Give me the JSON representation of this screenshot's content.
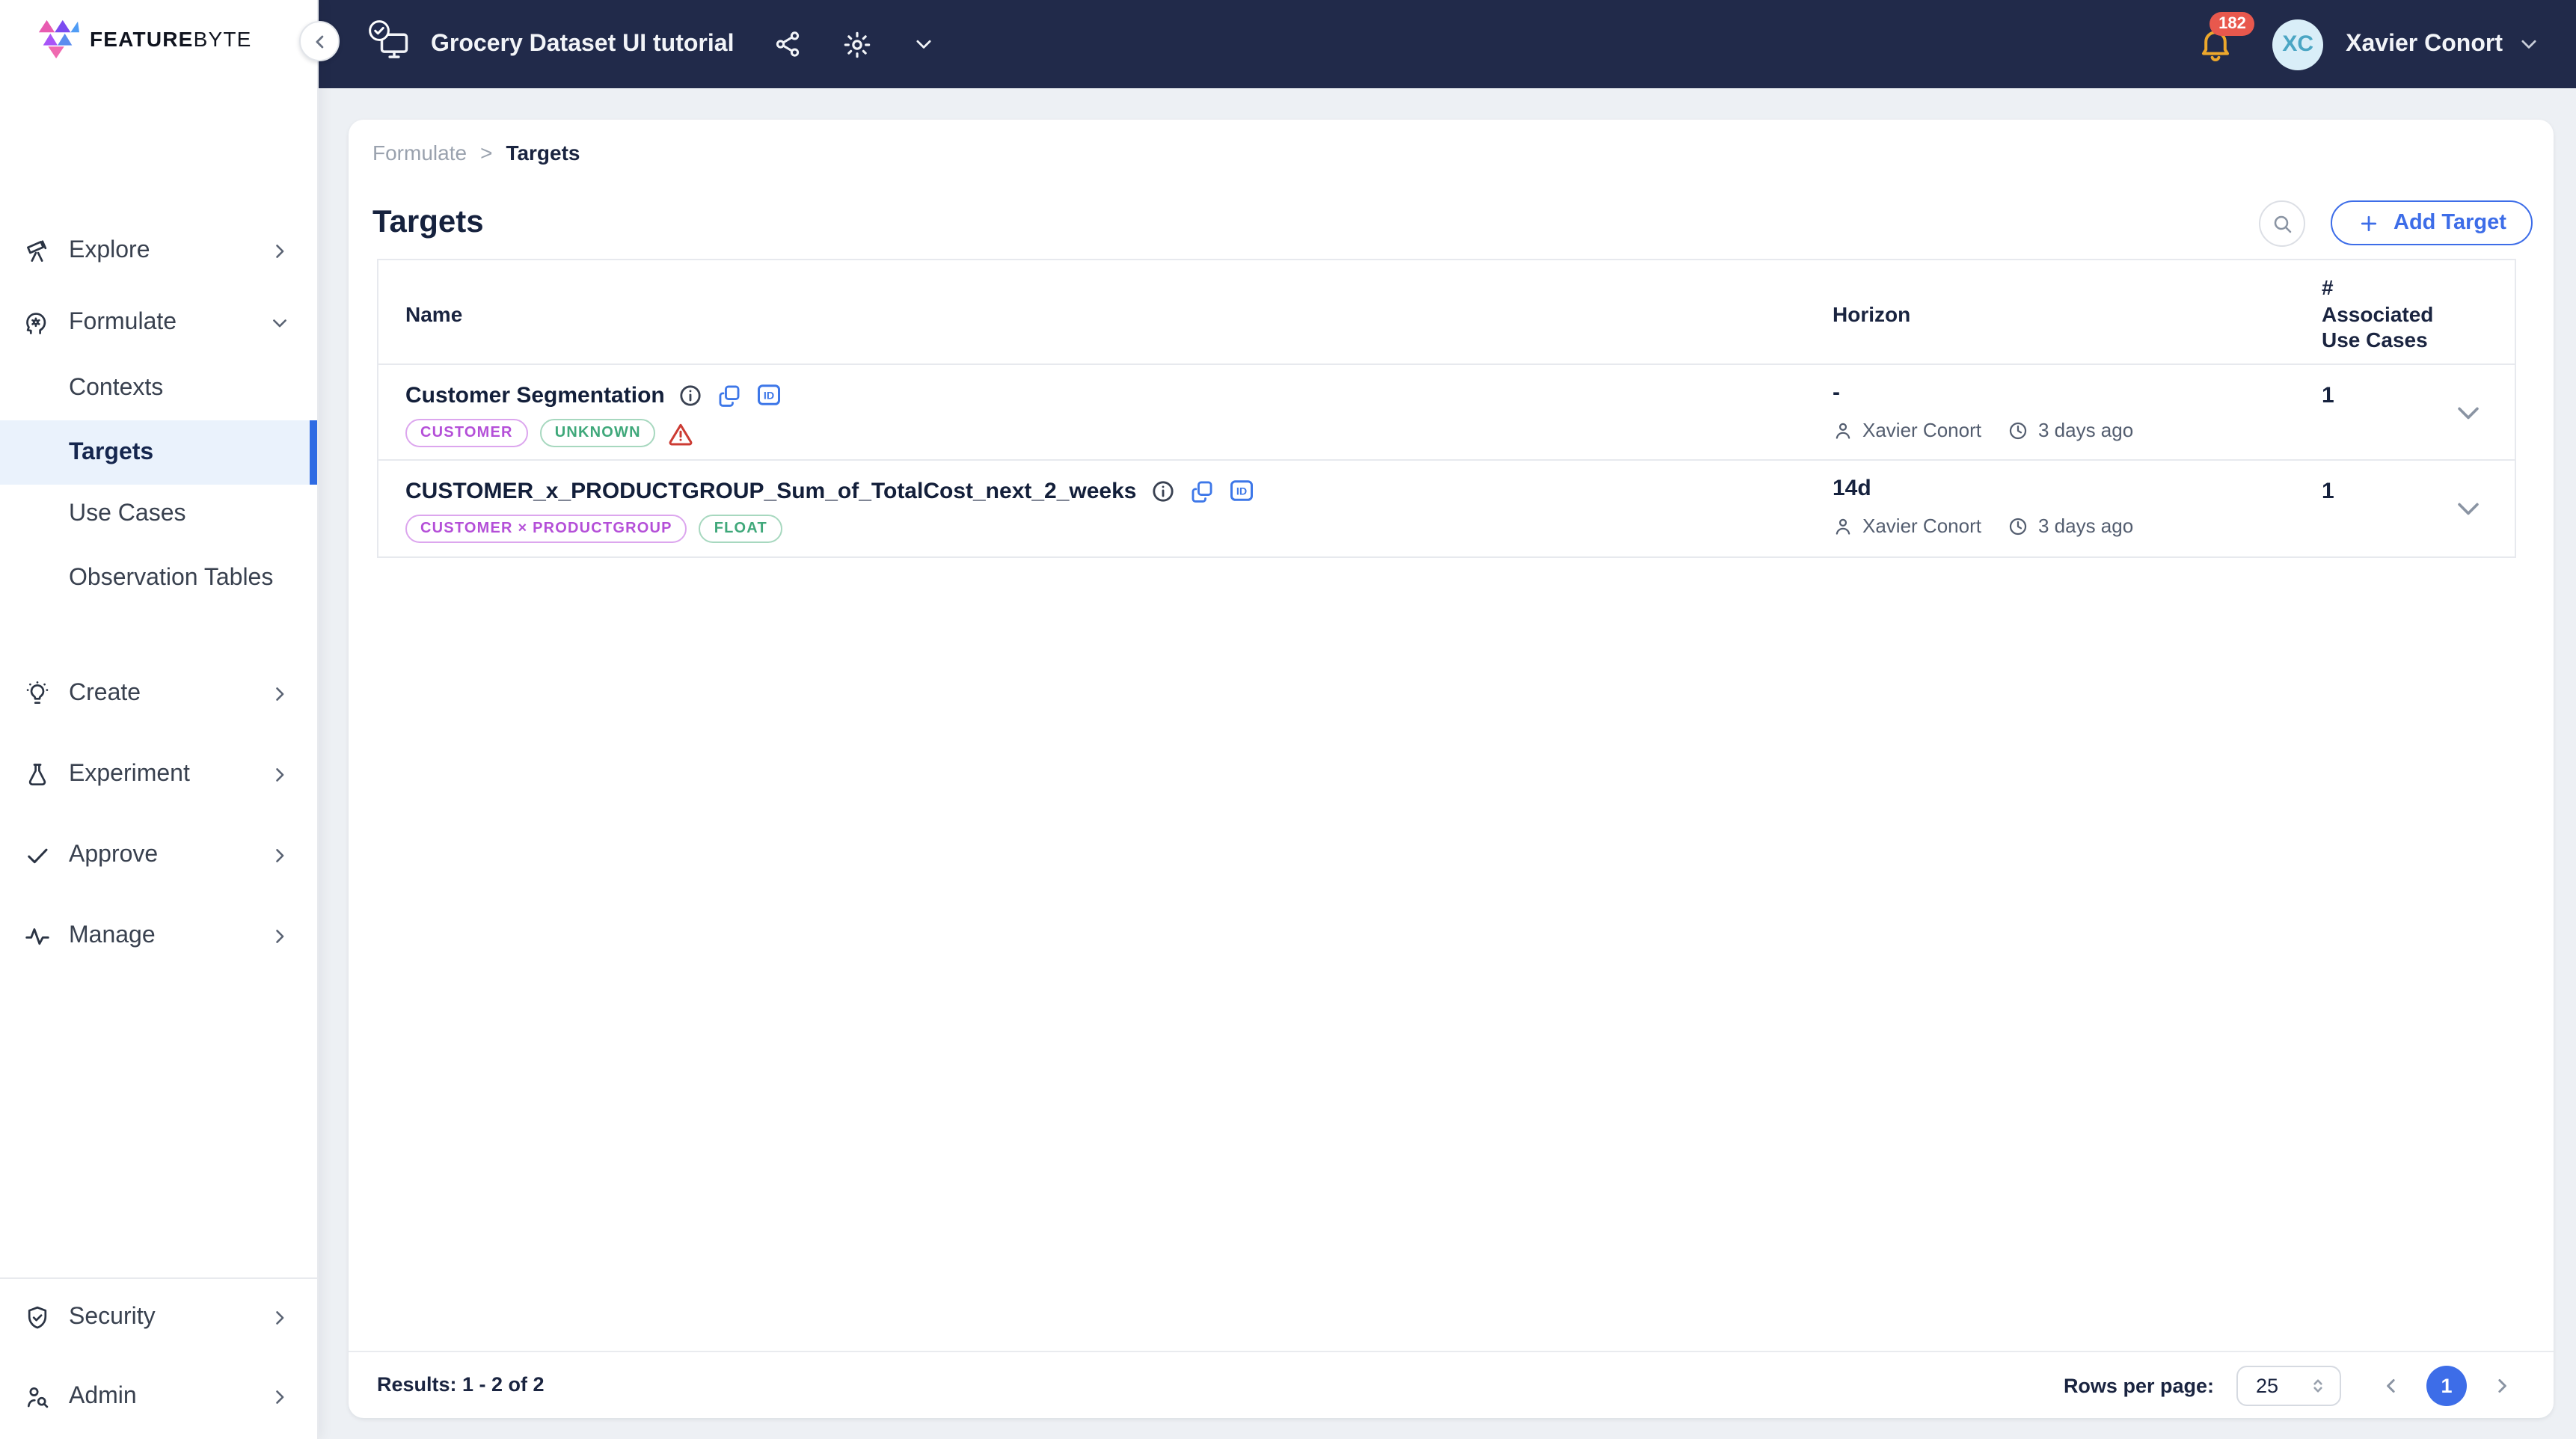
{
  "brand": {
    "feature": "FEATURE",
    "byte": "BYTE"
  },
  "top_header": {
    "project_title": "Grocery Dataset UI tutorial",
    "notifications_count": "182",
    "user_initials": "XC",
    "user_name": "Xavier Conort"
  },
  "sidebar": {
    "explore": "Explore",
    "formulate": "Formulate",
    "formulate_children": [
      "Contexts",
      "Targets",
      "Use Cases",
      "Observation Tables"
    ],
    "create": "Create",
    "experiment": "Experiment",
    "approve": "Approve",
    "manage": "Manage",
    "security": "Security",
    "admin": "Admin",
    "active_item": "Targets"
  },
  "breadcrumb": {
    "parent": "Formulate",
    "separator": ">",
    "current": "Targets"
  },
  "page": {
    "title": "Targets",
    "add_target_label": "Add Target"
  },
  "table": {
    "header": {
      "name": "Name",
      "horizon": "Horizon",
      "use_cases_line1": "#",
      "use_cases_line2": "Associated",
      "use_cases_line3": "Use Cases"
    },
    "rows": [
      {
        "name": "Customer Segmentation",
        "tag1": "CUSTOMER",
        "tag2": "UNKNOWN",
        "has_warning": true,
        "horizon": "-",
        "author": "Xavier Conort",
        "updated": "3 days ago",
        "use_case_count": "1"
      },
      {
        "name": "CUSTOMER_x_PRODUCTGROUP_Sum_of_TotalCost_next_2_weeks",
        "tag1": "CUSTOMER × PRODUCTGROUP",
        "tag2": "FLOAT",
        "has_warning": false,
        "horizon": "14d",
        "author": "Xavier Conort",
        "updated": "3 days ago",
        "use_case_count": "1"
      }
    ]
  },
  "footer": {
    "results_text": "Results: 1 - 2 of 2",
    "rows_per_page_label": "Rows per page:",
    "rows_per_page_value": "25",
    "current_page": "1"
  },
  "colors": {
    "header_bg": "#212A4A",
    "accent_blue": "#3D6DE8",
    "active_nav_bg": "#EAF2FC",
    "active_nav_bar": "#2F6BE3",
    "tag_purple": "#B44FD8",
    "tag_green": "#3FA87A",
    "warning_red": "#CC3B33",
    "bell_amber": "#ECA72C",
    "notification_badge_red": "#E8584D",
    "avatar_bg": "#D9EEF8",
    "avatar_text": "#4BA6C4"
  }
}
